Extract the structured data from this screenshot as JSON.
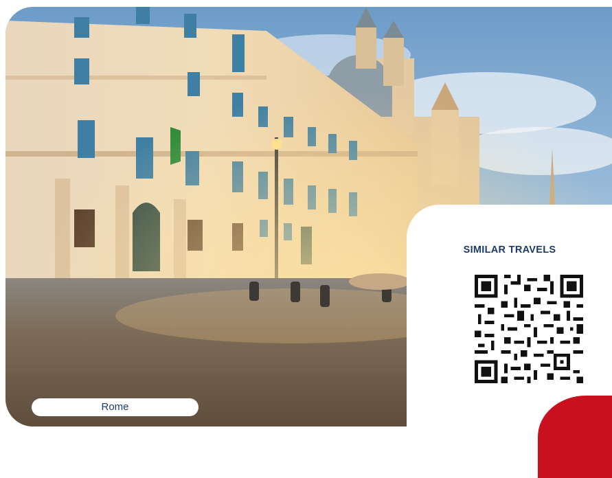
{
  "card": {
    "location_label": "Rome",
    "side_title": "SIMILAR TRAVELS",
    "photo_icon": "rome-piazza-photo",
    "qr_icon": "qr-code-icon",
    "accent_color": "#c8101e",
    "text_color": "#1d3b6a"
  }
}
